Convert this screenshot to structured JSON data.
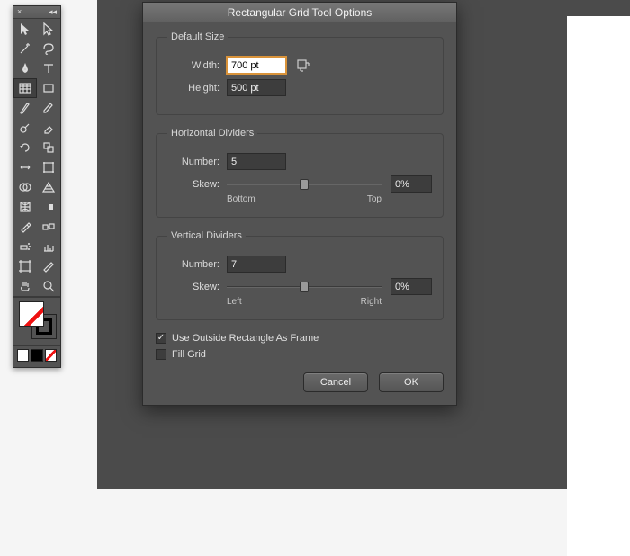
{
  "tools_header": {
    "close_glyph": "×",
    "collapse_glyph": "◂◂"
  },
  "tools": [
    {
      "name": "selection-tool-icon"
    },
    {
      "name": "direct-select-tool-icon"
    },
    {
      "name": "magic-wand-tool-icon"
    },
    {
      "name": "lasso-tool-icon"
    },
    {
      "name": "pen-tool-icon"
    },
    {
      "name": "type-tool-icon"
    },
    {
      "name": "rectangular-grid-tool-icon",
      "selected": true
    },
    {
      "name": "rectangle-tool-icon"
    },
    {
      "name": "paintbrush-tool-icon"
    },
    {
      "name": "pencil-tool-icon"
    },
    {
      "name": "blob-brush-tool-icon"
    },
    {
      "name": "eraser-tool-icon"
    },
    {
      "name": "rotate-tool-icon"
    },
    {
      "name": "scale-tool-icon"
    },
    {
      "name": "width-tool-icon"
    },
    {
      "name": "free-transform-tool-icon"
    },
    {
      "name": "shape-builder-tool-icon"
    },
    {
      "name": "perspective-grid-tool-icon"
    },
    {
      "name": "mesh-tool-icon"
    },
    {
      "name": "gradient-tool-icon"
    },
    {
      "name": "eyedropper-tool-icon"
    },
    {
      "name": "blend-tool-icon"
    },
    {
      "name": "symbol-sprayer-tool-icon"
    },
    {
      "name": "column-graph-tool-icon"
    },
    {
      "name": "artboard-tool-icon"
    },
    {
      "name": "slice-tool-icon"
    },
    {
      "name": "hand-tool-icon"
    },
    {
      "name": "zoom-tool-icon"
    }
  ],
  "dialog": {
    "title": "Rectangular Grid Tool Options",
    "default_size": {
      "legend": "Default Size",
      "width_label": "Width:",
      "width_value": "700 pt",
      "height_label": "Height:",
      "height_value": "500 pt"
    },
    "horizontal": {
      "legend": "Horizontal Dividers",
      "number_label": "Number:",
      "number_value": "5",
      "skew_label": "Skew:",
      "skew_value": "0%",
      "left_label": "Bottom",
      "right_label": "Top"
    },
    "vertical": {
      "legend": "Vertical Dividers",
      "number_label": "Number:",
      "number_value": "7",
      "skew_label": "Skew:",
      "skew_value": "0%",
      "left_label": "Left",
      "right_label": "Right"
    },
    "use_outside_label": "Use Outside Rectangle As Frame",
    "use_outside_checked": "✓",
    "fill_grid_label": "Fill Grid",
    "cancel_label": "Cancel",
    "ok_label": "OK"
  }
}
